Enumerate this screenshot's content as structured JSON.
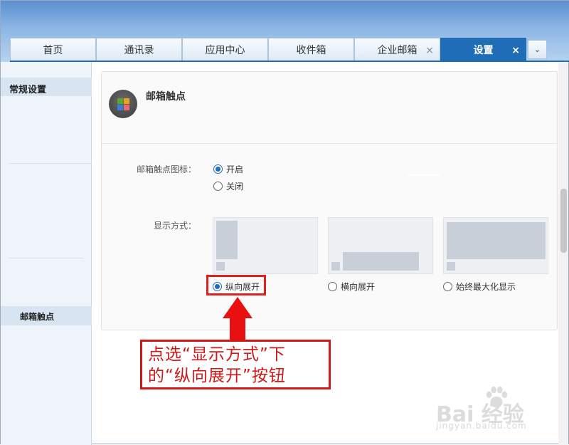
{
  "tabs": [
    {
      "label": "首页",
      "closable": false,
      "active": false
    },
    {
      "label": "通讯录",
      "closable": false,
      "active": false
    },
    {
      "label": "应用中心",
      "closable": false,
      "active": false
    },
    {
      "label": "收件箱",
      "closable": false,
      "active": false
    },
    {
      "label": "企业邮箱",
      "closable": true,
      "active": false
    },
    {
      "label": "设置",
      "closable": true,
      "active": true
    }
  ],
  "tab_close_glyph": "×",
  "tab_more_glyph": "⌄",
  "sidebar": {
    "heading": "常规设置",
    "selected_item": "邮箱触点"
  },
  "panel": {
    "title": "邮箱触点",
    "icon_label": "邮箱触点 app icon",
    "icon_toggle": {
      "label": "邮箱触点图标：",
      "options": [
        "开启",
        "关闭"
      ],
      "selected": "开启"
    },
    "display_mode": {
      "label": "显示方式：",
      "options": [
        "纵向展开",
        "横向展开",
        "始终最大化显示"
      ],
      "selected": "纵向展开"
    }
  },
  "annotation": {
    "line1": "点选“显示方式”下",
    "line2": "的“纵向展开”按钮"
  },
  "watermark": {
    "brand": "Bai  经验",
    "url": "jingyan.baidu.com"
  },
  "colors": {
    "accent": "#1f6db7",
    "annotation_red": "#d01818"
  }
}
